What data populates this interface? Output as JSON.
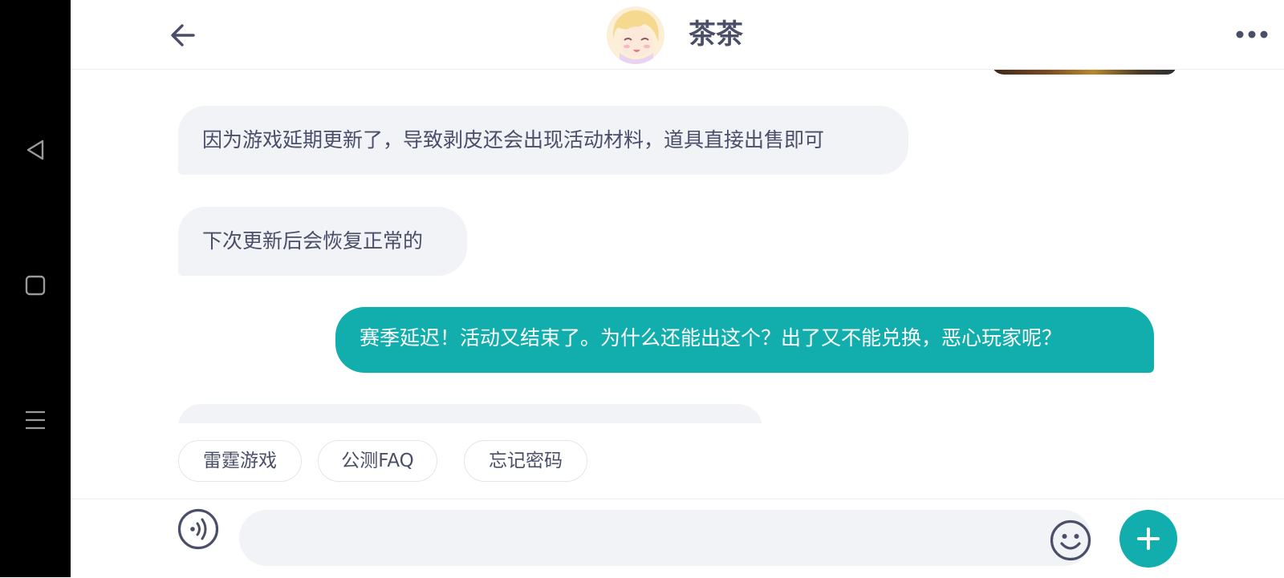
{
  "header": {
    "title": "茶茶"
  },
  "messages": [
    {
      "side": "in",
      "text": "因为游戏延期更新了，导致剥皮还会出现活动材料，道具直接出售即可"
    },
    {
      "side": "in",
      "text": "下次更新后会恢复正常的"
    },
    {
      "side": "out",
      "text": "赛季延迟！活动又结束了。为什么还能出这个？出了又不能兑换，恶心玩家呢？"
    }
  ],
  "quick_replies": [
    "雷霆游戏",
    "公测FAQ",
    "忘记密码"
  ],
  "input": {
    "value": ""
  },
  "colors": {
    "accent": "#11aead",
    "text": "#4a4e69",
    "bubble_in": "#f1f3f6"
  },
  "icons": {
    "nav": [
      "back-triangle-icon",
      "home-square-icon",
      "menu-lines-icon"
    ],
    "header": [
      "arrow-left-icon",
      "more-dots-icon"
    ],
    "input": [
      "voice-icon",
      "emoji-icon",
      "plus-icon"
    ]
  }
}
